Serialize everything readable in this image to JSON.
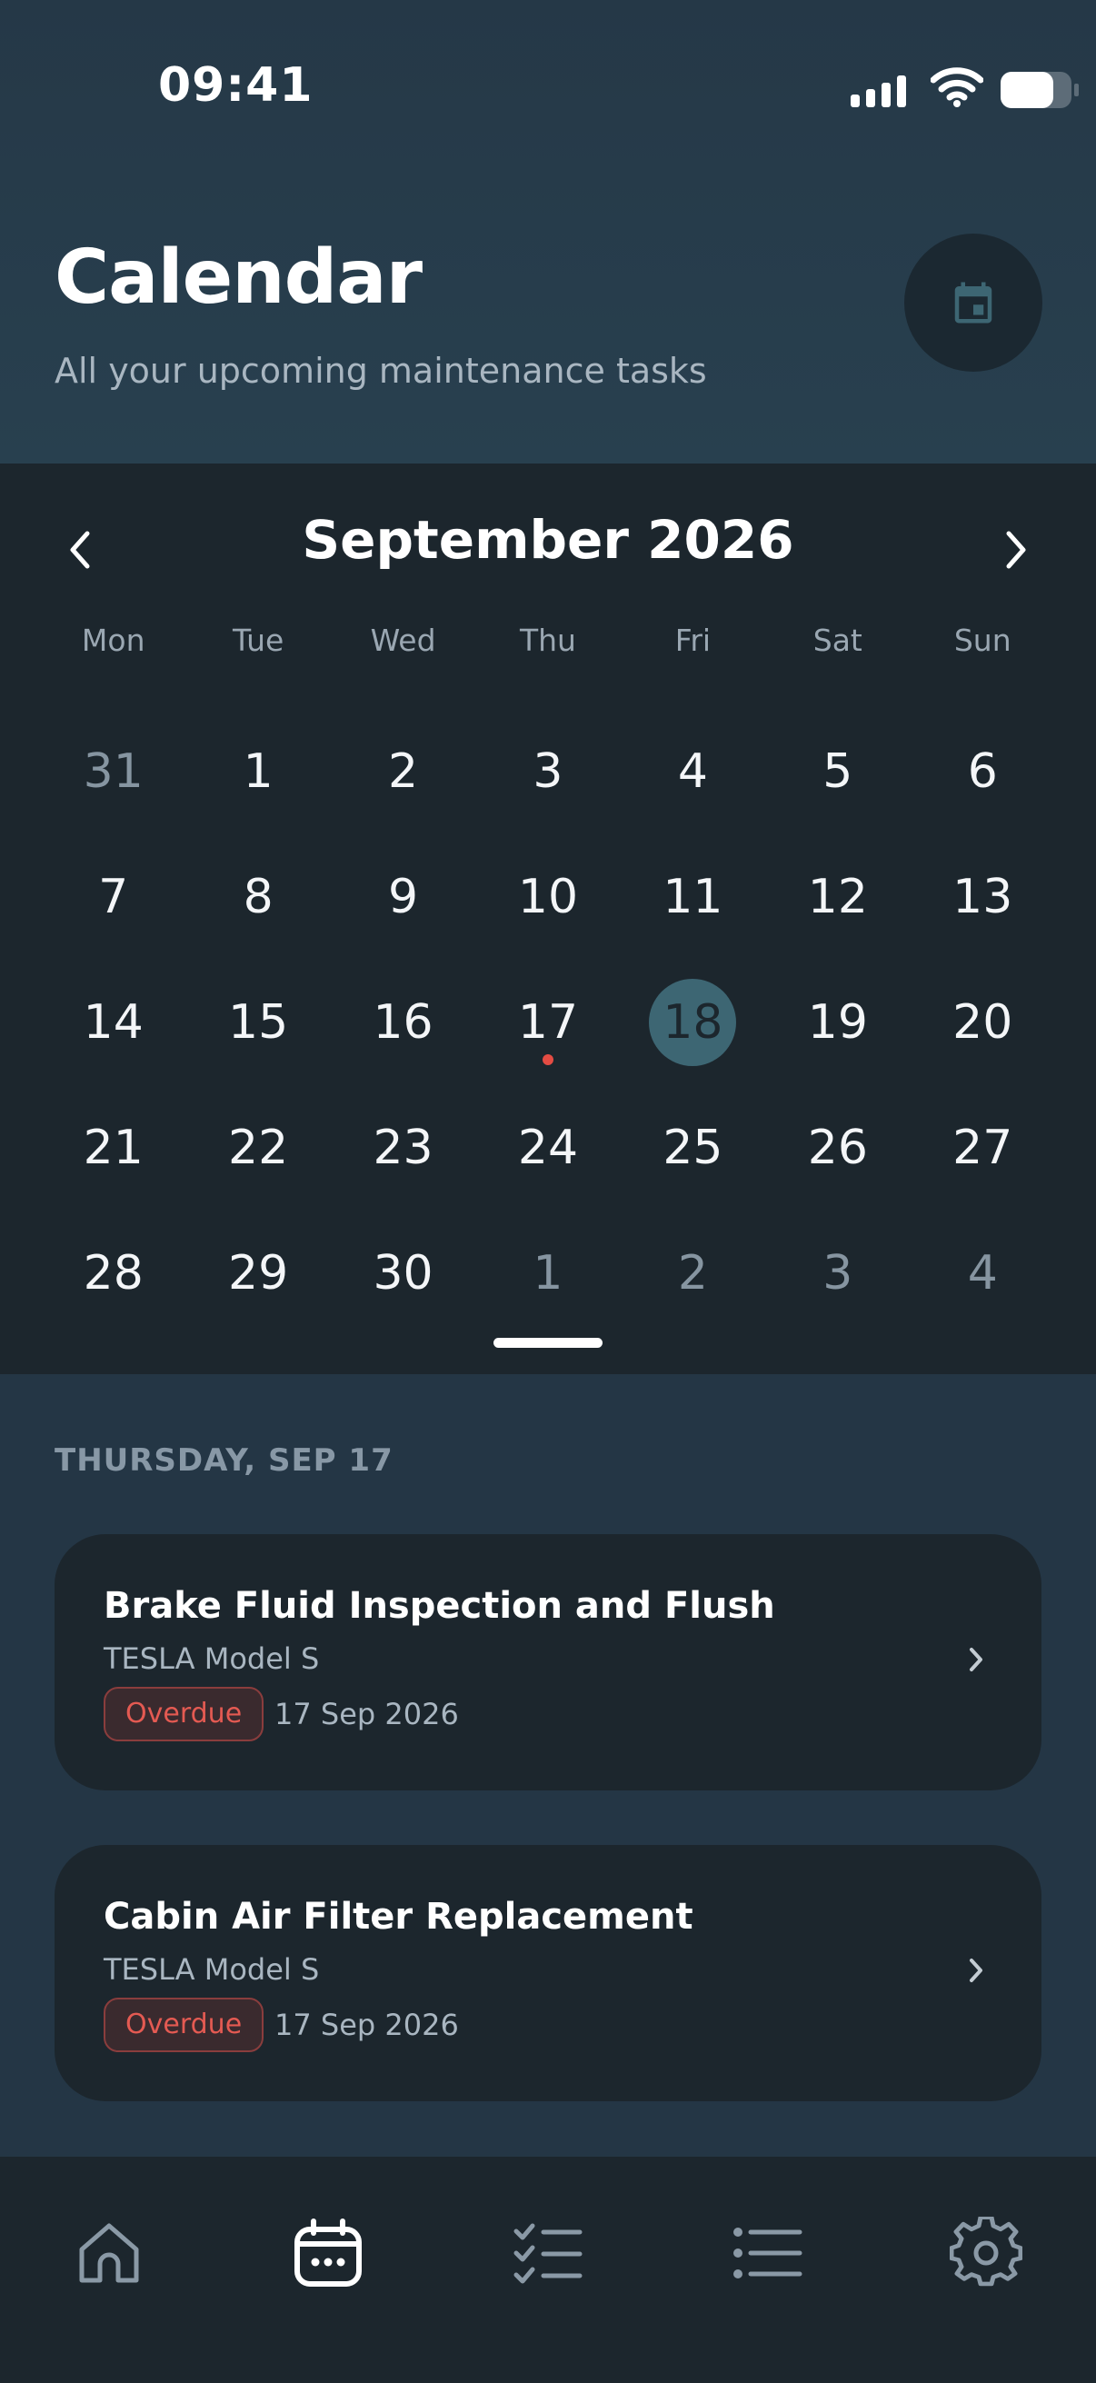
{
  "status_bar": {
    "time": "09:41",
    "icons": [
      "signal-icon",
      "wifi-icon",
      "battery-icon"
    ]
  },
  "header": {
    "title": "Calendar",
    "subtitle": "All your upcoming maintenance tasks",
    "action_icon": "calendar-icon"
  },
  "calendar": {
    "month_label": "September 2026",
    "weekdays": [
      "Mon",
      "Tue",
      "Wed",
      "Thu",
      "Fri",
      "Sat",
      "Sun"
    ],
    "weeks": [
      [
        {
          "day": "31",
          "muted": true
        },
        {
          "day": "1"
        },
        {
          "day": "2"
        },
        {
          "day": "3"
        },
        {
          "day": "4"
        },
        {
          "day": "5"
        },
        {
          "day": "6"
        }
      ],
      [
        {
          "day": "7"
        },
        {
          "day": "8"
        },
        {
          "day": "9"
        },
        {
          "day": "10"
        },
        {
          "day": "11"
        },
        {
          "day": "12"
        },
        {
          "day": "13"
        }
      ],
      [
        {
          "day": "14"
        },
        {
          "day": "15"
        },
        {
          "day": "16"
        },
        {
          "day": "17",
          "has_event": true
        },
        {
          "day": "18",
          "selected": true
        },
        {
          "day": "19"
        },
        {
          "day": "20"
        }
      ],
      [
        {
          "day": "21"
        },
        {
          "day": "22"
        },
        {
          "day": "23"
        },
        {
          "day": "24"
        },
        {
          "day": "25"
        },
        {
          "day": "26"
        },
        {
          "day": "27"
        }
      ],
      [
        {
          "day": "28"
        },
        {
          "day": "29"
        },
        {
          "day": "30"
        },
        {
          "day": "1",
          "muted": true
        },
        {
          "day": "2",
          "muted": true
        },
        {
          "day": "3",
          "muted": true
        },
        {
          "day": "4",
          "muted": true
        }
      ]
    ],
    "colors": {
      "selected_fill": "#3d6673",
      "event_dot": "#e44c43"
    }
  },
  "tasks_section": {
    "header": "THURSDAY, SEP 17",
    "tasks": [
      {
        "title": "Brake Fluid Inspection and Flush",
        "vehicle": "TESLA Model S",
        "status": "Overdue",
        "date": "17 Sep 2026"
      },
      {
        "title": "Cabin Air Filter Replacement",
        "vehicle": "TESLA Model S",
        "status": "Overdue",
        "date": "17 Sep 2026"
      }
    ]
  },
  "bottom_nav": {
    "tabs": [
      {
        "icon": "home-icon",
        "active": false
      },
      {
        "icon": "calendar-icon",
        "active": true
      },
      {
        "icon": "checklist-icon",
        "active": false
      },
      {
        "icon": "list-icon",
        "active": false
      },
      {
        "icon": "settings-icon",
        "active": false
      }
    ]
  }
}
